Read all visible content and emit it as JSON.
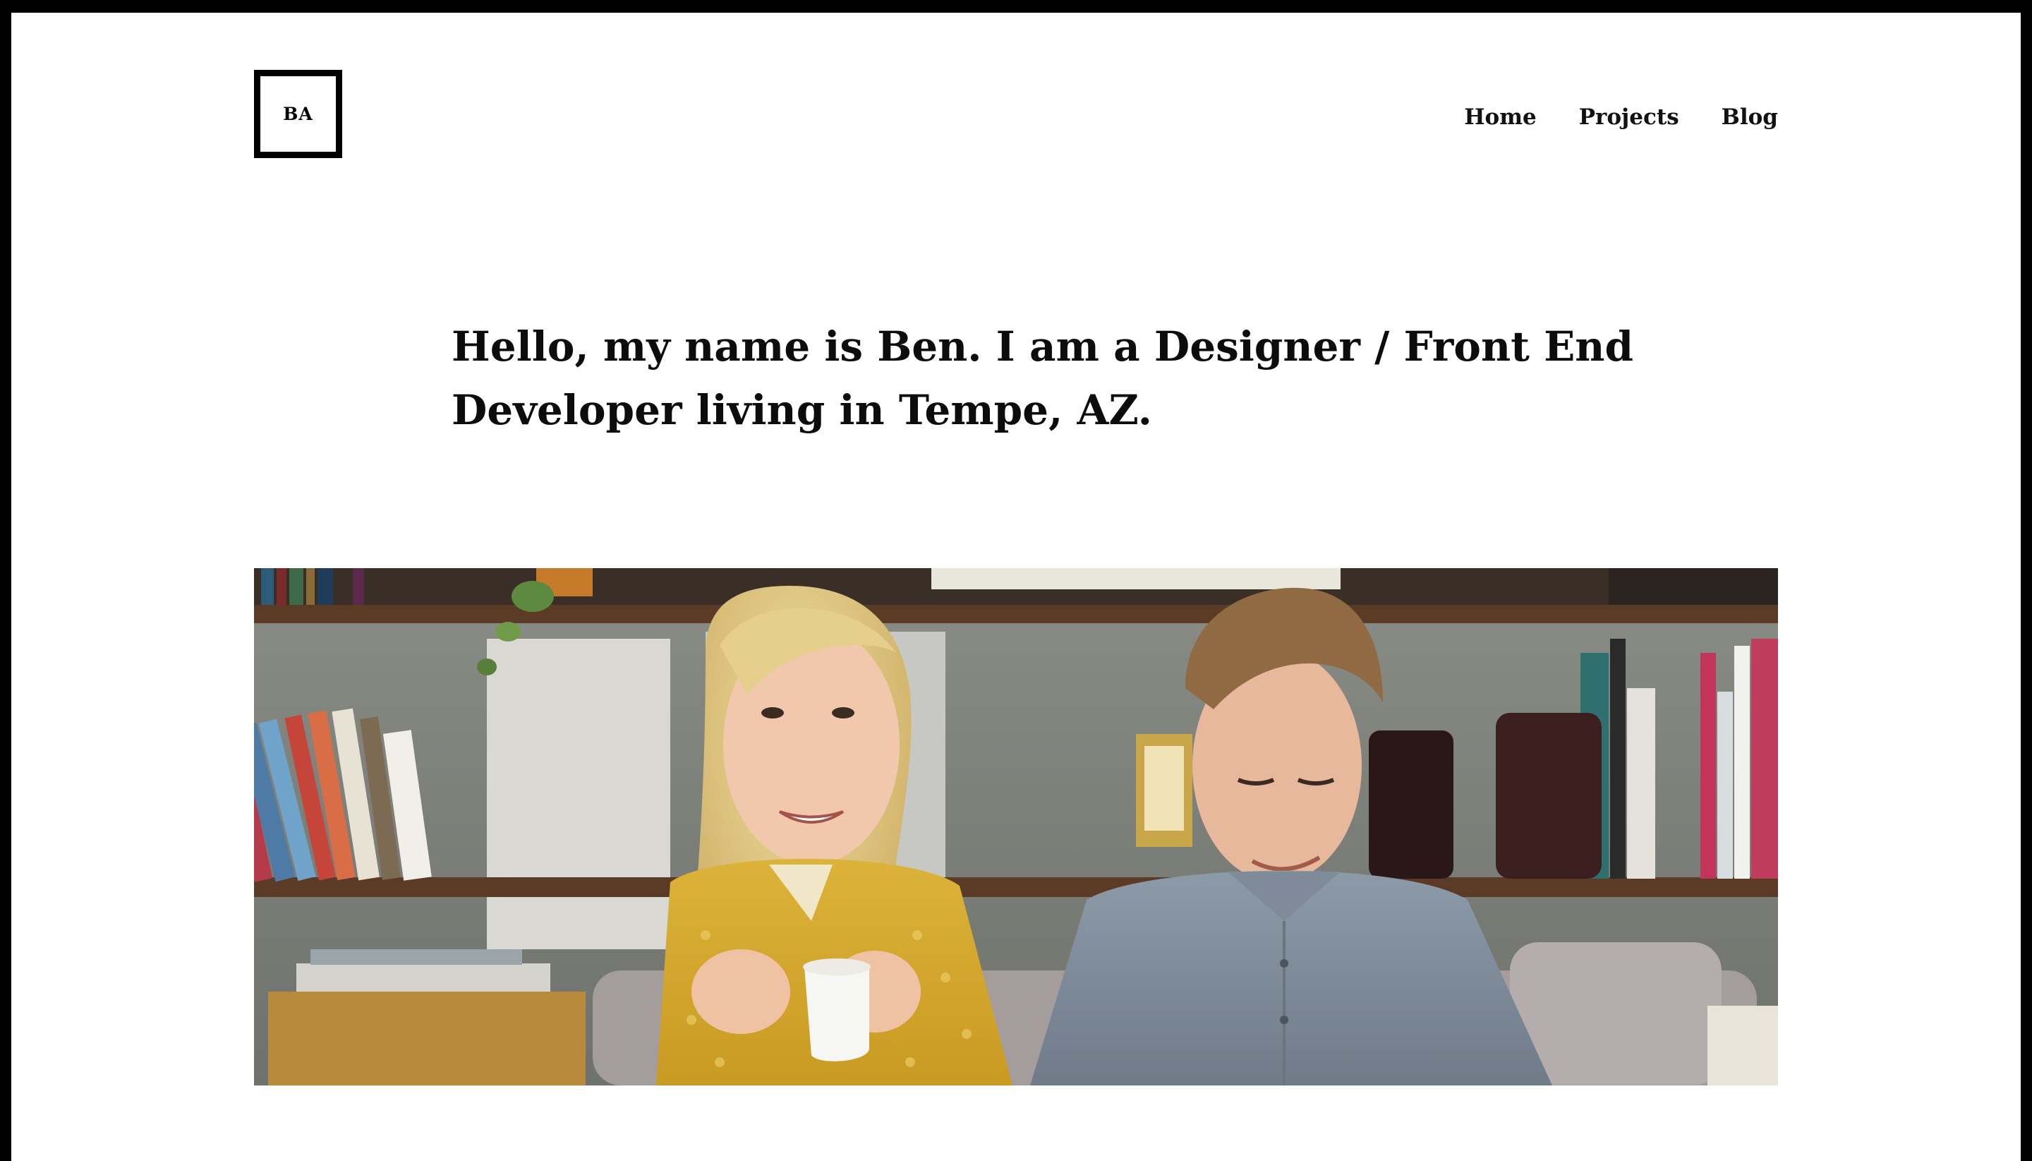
{
  "logo": {
    "text": "BA"
  },
  "nav": {
    "items": [
      {
        "label": "Home"
      },
      {
        "label": "Projects"
      },
      {
        "label": "Blog"
      }
    ]
  },
  "hero": {
    "intro": "Hello, my name is Ben. I am a Designer / Front End Developer living in Tempe, AZ."
  },
  "colors": {
    "frame": "#000000",
    "background": "#ffffff",
    "text": "#111111"
  }
}
